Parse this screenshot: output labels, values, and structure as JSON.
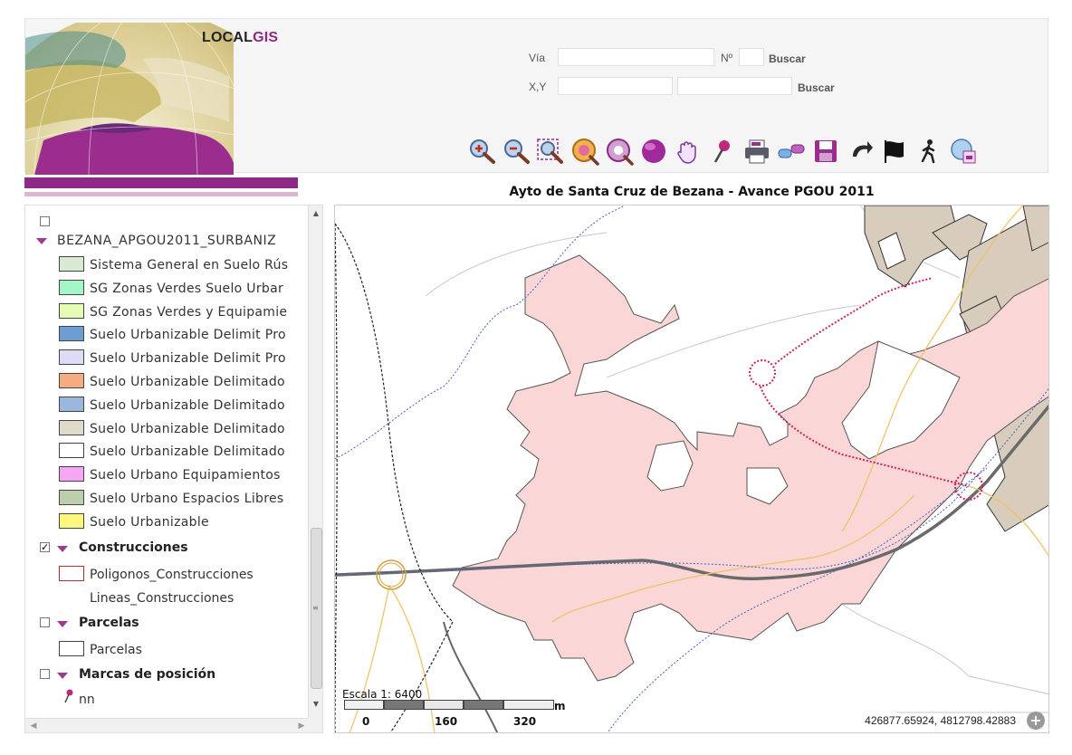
{
  "header": {
    "logo_local": "LOCAL",
    "logo_gis": "GIS",
    "via_label": "Vía",
    "no_label": "Nº",
    "buscar_label_1": "Buscar",
    "xy_label": "X,Y",
    "buscar_label_2": "Buscar",
    "via_value": "",
    "no_value": "",
    "x_value": "",
    "y_value": ""
  },
  "toolbar": {
    "tools": [
      "zoom-in-icon",
      "zoom-out-icon",
      "zoom-box-icon",
      "zoom-extent-icon",
      "zoom-layer-icon",
      "globe-icon",
      "pan-hand-icon",
      "pin-icon",
      "print-icon",
      "measure-icon",
      "save-icon",
      "back-arrow-icon",
      "flag-icon",
      "walk-icon",
      "legend-icon"
    ]
  },
  "map": {
    "title": "Ayto de Santa Cruz de Bezana - Avance PGOU 2011",
    "scale_label": "Escala 1: 6400",
    "scale_ticks": [
      "0",
      "160",
      "320"
    ],
    "scale_unit": "m",
    "coordinates": "426877.65924, 4812798.42883",
    "zoom_button": "+"
  },
  "legend": {
    "layer_group": "BEZANA_APGOU2011_SURBANIZ",
    "items": [
      {
        "label": "Sistema General en Suelo Rús",
        "color": "#d9ead3"
      },
      {
        "label": "SG Zonas Verdes Suelo Urbar",
        "color": "#a4f5c6"
      },
      {
        "label": "SG Zonas Verdes y Equipamie",
        "color": "#e6fcb4"
      },
      {
        "label": "Suelo Urbanizable Delimit Pro",
        "color": "#6d9ed2"
      },
      {
        "label": "Suelo Urbanizable Delimit Pro",
        "color": "#dcdcf6"
      },
      {
        "label": "Suelo Urbanizable Delimitado",
        "color": "#f7ab83"
      },
      {
        "label": "Suelo Urbanizable Delimitado",
        "color": "#9bb8dc"
      },
      {
        "label": "Suelo Urbanizable Delimitado",
        "color": "#dedbcb"
      },
      {
        "label": "Suelo Urbanizable Delimitado",
        "color": "#ffffff"
      },
      {
        "label": "Suelo Urbano Equipamientos",
        "color": "#f6a6f2"
      },
      {
        "label": "Suelo Urbano Espacios Libres",
        "color": "#bcceaa"
      },
      {
        "label": "Suelo Urbanizable",
        "color": "#fdf77e"
      }
    ],
    "construcciones": {
      "title": "Construcciones",
      "checked": true,
      "poligonos": "Poligonos_Construcciones",
      "lineas": "Lineas_Construcciones"
    },
    "parcelas": {
      "title": "Parcelas",
      "item": "Parcelas"
    },
    "marcas": {
      "title": "Marcas de posición",
      "item": "nn"
    }
  }
}
